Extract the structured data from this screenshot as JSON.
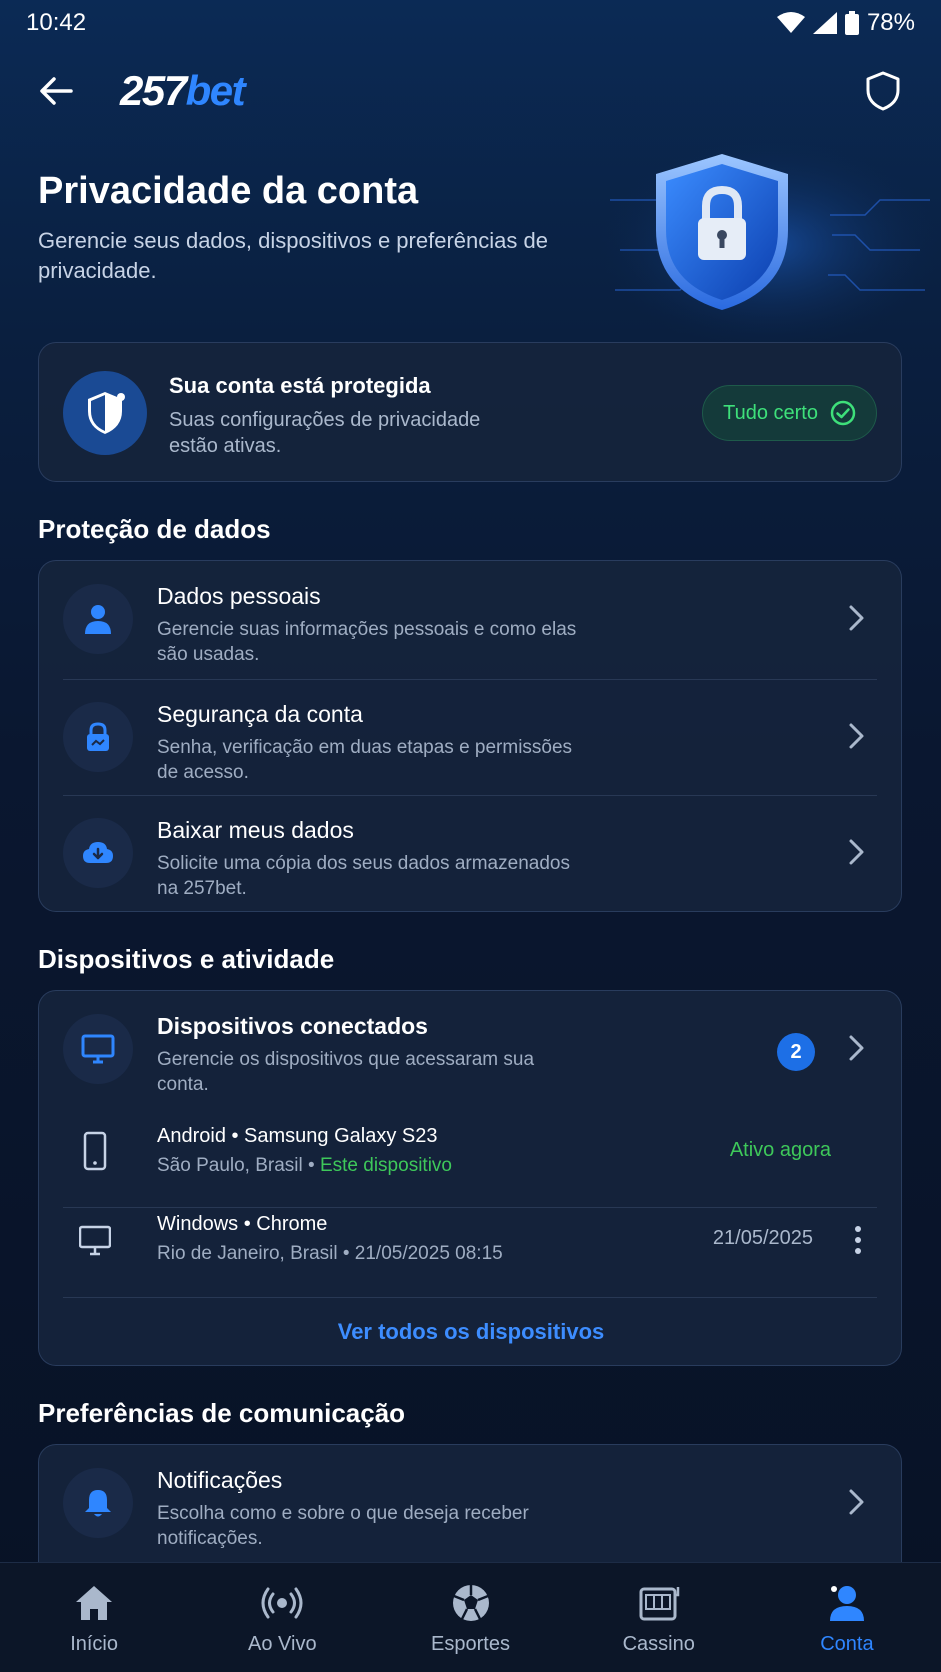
{
  "status_bar": {
    "time": "10:42",
    "battery": "78%"
  },
  "header": {
    "logo_num": "257",
    "logo_bet": "bet"
  },
  "hero": {
    "title": "Privacidade da conta",
    "subtitle": "Gerencie seus dados, dispositivos e preferências de privacidade."
  },
  "protected": {
    "title": "Sua conta está protegida",
    "subtitle": "Suas configurações de privacidade estão ativas.",
    "badge": "Tudo certo"
  },
  "data_protection": {
    "title": "Proteção de dados",
    "items": [
      {
        "title": "Dados pessoais",
        "subtitle": "Gerencie suas informações pessoais e como elas são usadas."
      },
      {
        "title": "Segurança da conta",
        "subtitle": "Senha, verificação em duas etapas e permissões de acesso."
      },
      {
        "title": "Baixar meus dados",
        "subtitle": "Solicite uma cópia dos seus dados armazenados na 257bet."
      }
    ]
  },
  "devices": {
    "title": "Dispositivos e atividade",
    "connected_title": "Dispositivos conectados",
    "connected_subtitle": "Gerencie os dispositivos que acessaram sua conta.",
    "count": "2",
    "list": [
      {
        "name": "Android • Samsung Galaxy S23",
        "location": "São Paulo, Brasil • ",
        "current": "Este dispositivo",
        "status": "Ativo agora"
      },
      {
        "name": "Windows • Chrome",
        "location": "Rio de Janeiro, Brasil • 21/05/2025 08:15",
        "date": "21/05/2025"
      }
    ],
    "see_all": "Ver todos os dispositivos"
  },
  "communication": {
    "title": "Preferências de comunicação",
    "items": [
      {
        "title": "Notificações",
        "subtitle": "Escolha como e sobre o que deseja receber notificações."
      }
    ]
  },
  "nav": {
    "items": [
      {
        "label": "Início",
        "icon": "home-icon"
      },
      {
        "label": "Ao Vivo",
        "icon": "live-icon"
      },
      {
        "label": "Esportes",
        "icon": "soccer-ball-icon"
      },
      {
        "label": "Cassino",
        "icon": "slot-machine-icon"
      },
      {
        "label": "Conta",
        "icon": "user-icon"
      }
    ],
    "active": "Conta"
  },
  "colors": {
    "accent": "#2f86ff",
    "success": "#3ec85a",
    "background": "#0a1730"
  }
}
